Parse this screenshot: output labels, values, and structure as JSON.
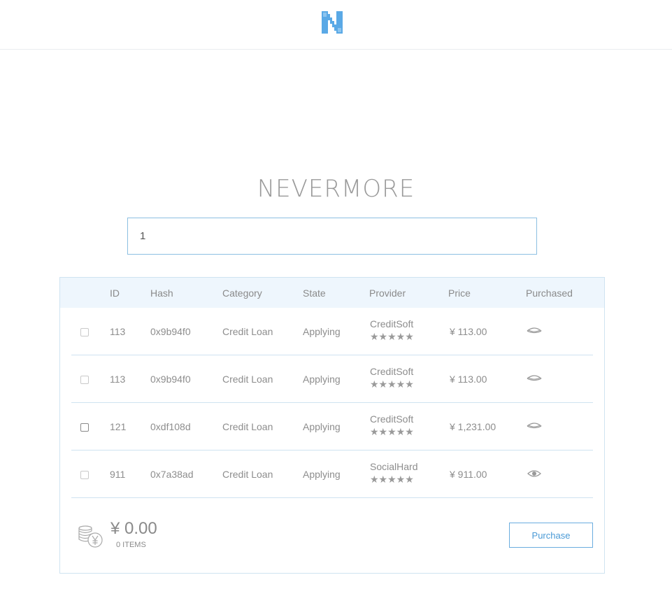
{
  "header": {
    "logo_icon": "nevermore-n-logo-icon",
    "accent_color": "#5aa9e6"
  },
  "app": {
    "title": "NEVERMORE"
  },
  "search": {
    "value": "1"
  },
  "table": {
    "columns": [
      "ID",
      "Hash",
      "Category",
      "State",
      "Provider",
      "Price",
      "Purchased"
    ],
    "rows": [
      {
        "id": "113",
        "hash": "0x9b94f0",
        "category": "Credit Loan",
        "state": "Applying",
        "provider": "CreditSoft",
        "stars": "★★★★★",
        "price": "¥ 113.00",
        "purchased_icon": "eye-closed-icon"
      },
      {
        "id": "113",
        "hash": "0x9b94f0",
        "category": "Credit Loan",
        "state": "Applying",
        "provider": "CreditSoft",
        "stars": "★★★★★",
        "price": "¥ 113.00",
        "purchased_icon": "eye-closed-icon"
      },
      {
        "id": "121",
        "hash": "0xdf108d",
        "category": "Credit Loan",
        "state": "Applying",
        "provider": "CreditSoft",
        "stars": "★★★★★",
        "price": "¥ 1,231.00",
        "purchased_icon": "eye-closed-icon"
      },
      {
        "id": "911",
        "hash": "0x7a38ad",
        "category": "Credit Loan",
        "state": "Applying",
        "provider": "SocialHard",
        "stars": "★★★★★",
        "price": "¥ 911.00",
        "purchased_icon": "eye-open-icon"
      }
    ]
  },
  "footer": {
    "total": "¥ 0.00",
    "items": "0 ITEMS",
    "coins_icon": "coins-yen-icon",
    "purchase_label": "Purchase"
  }
}
